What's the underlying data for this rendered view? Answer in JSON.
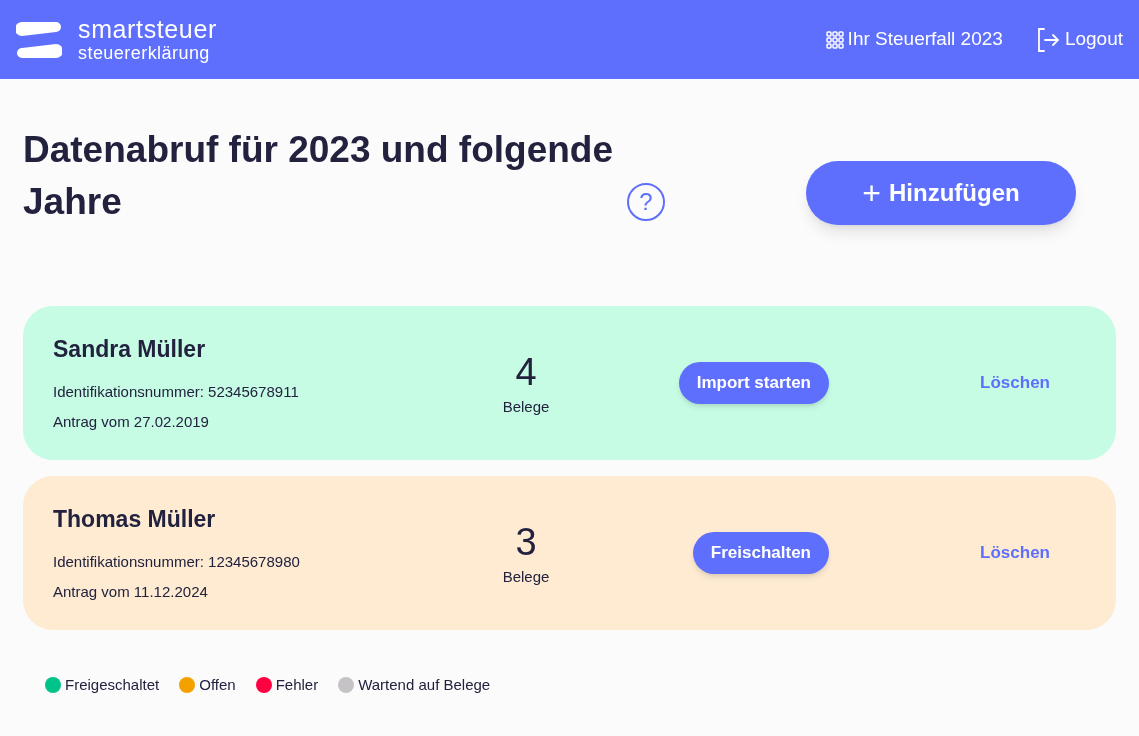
{
  "header": {
    "logo_title": "smartsteuer",
    "logo_subtitle": "steuererklärung",
    "nav": [
      {
        "kind": "case",
        "label": "Ihr Steuerfall 2023"
      },
      {
        "kind": "logout",
        "label": "Logout"
      }
    ]
  },
  "page": {
    "title": "Datenabruf für 2023 und folgende Jahre",
    "help": "?",
    "add_button": "Hinzufügen",
    "add_icon": "+"
  },
  "cards": [
    {
      "name": "Sandra Müller",
      "id_line": "Identifikationsnummer: 52345678911",
      "date_line": "Antrag vom 27.02.2019",
      "count": "4",
      "count_label": "Belege",
      "action": "Import starten",
      "delete": "Löschen",
      "color": "#c7fce4"
    },
    {
      "name": "Thomas Müller",
      "id_line": "Identifikationsnummer: 12345678980",
      "date_line": "Antrag vom 11.12.2024",
      "count": "3",
      "count_label": "Belege",
      "action": "Freischalten",
      "delete": "Löschen",
      "color": "#feebd2"
    }
  ],
  "legend": [
    {
      "label": "Freigeschaltet",
      "color": "#00c389"
    },
    {
      "label": "Offen",
      "color": "#f4a100"
    },
    {
      "label": "Fehler",
      "color": "#ff0040"
    },
    {
      "label": "Wartend auf Belege",
      "color": "#c6c3c6"
    }
  ]
}
